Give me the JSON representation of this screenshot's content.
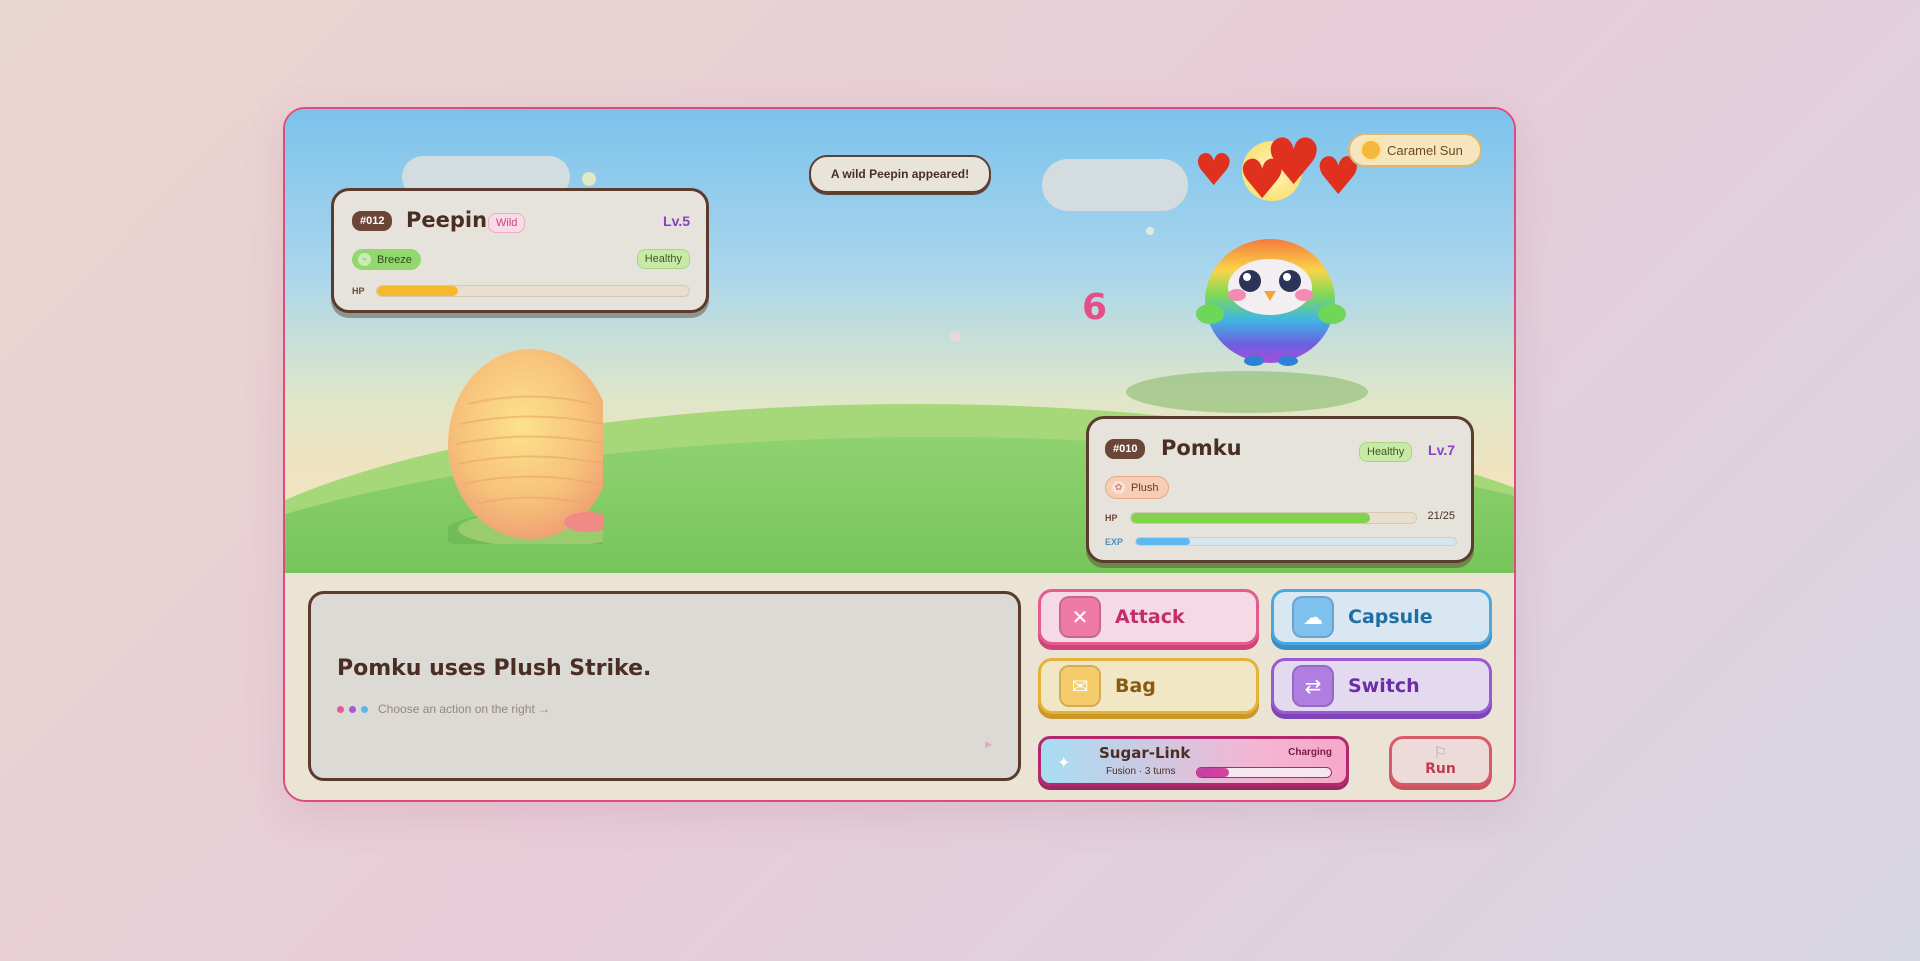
{
  "scene": {
    "toast": "A wild Peepin appeared!",
    "weather": {
      "label": "Caramel Sun",
      "icon": "sun-icon"
    },
    "floating_number": "6"
  },
  "enemy": {
    "number": "#012",
    "name": "Peepin",
    "status_tag": "Wild",
    "level": "Lv.5",
    "type": {
      "label": "Breeze",
      "icon": "wind-icon"
    },
    "condition": "Healthy",
    "hp_label": "HP",
    "hp_fraction": 0.26,
    "hp_color": "#f6b92e"
  },
  "player": {
    "number": "#010",
    "name": "Pomku",
    "condition": "Healthy",
    "level": "Lv.7",
    "type": {
      "label": "Plush",
      "icon": "plush-icon"
    },
    "hp_label": "HP",
    "hp_text": "21/25",
    "hp_fraction": 0.84,
    "hp_color": "#7fd34d",
    "exp_label": "EXP",
    "exp_fraction": 0.17,
    "exp_color": "#5cb8ee"
  },
  "message": {
    "main": "Pomku uses Plush Strike.",
    "hint": "Choose an action on the right →",
    "dot_colors": [
      "#ea5a9a",
      "#a05bd6",
      "#58b6ec"
    ]
  },
  "actions": {
    "attack": {
      "label": "Attack",
      "icon": "crossed-swords-icon"
    },
    "capsule": {
      "label": "Capsule",
      "icon": "cloud-icon"
    },
    "bag": {
      "label": "Bag",
      "icon": "bag-icon"
    },
    "switch": {
      "label": "Switch",
      "icon": "swap-icon"
    }
  },
  "sugar_link": {
    "title": "Sugar-Link",
    "subtitle": "Fusion · 3 turns",
    "status": "Charging",
    "charge_fraction": 0.24,
    "icon": "wand-icon"
  },
  "run": {
    "label": "Run",
    "icon": "flag-icon"
  }
}
